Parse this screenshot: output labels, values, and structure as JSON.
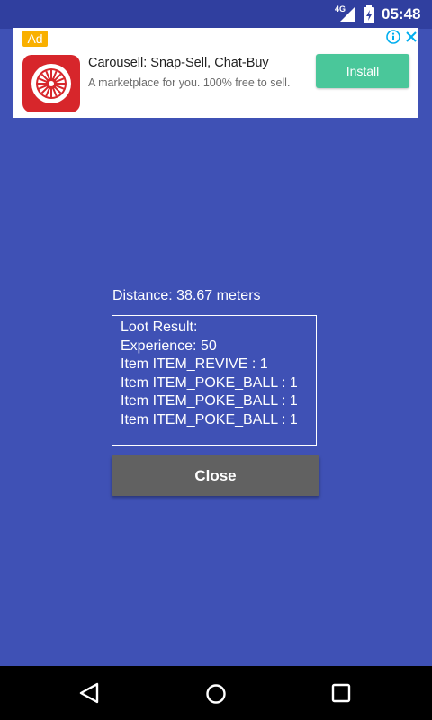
{
  "status_bar": {
    "network_type": "4G",
    "time": "05:48",
    "icons": [
      "signal-icon",
      "battery-icon"
    ]
  },
  "ad": {
    "badge": "Ad",
    "title": "Carousell: Snap-Sell, Chat-Buy",
    "description": "A marketplace for you. 100% free to sell.",
    "install_label": "Install",
    "icons": [
      "ad-info-icon",
      "ad-close-icon",
      "carousell-app-icon"
    ],
    "colors": {
      "install_button": "#4AC79A",
      "badge": "#F9B000",
      "app_icon": "#D7262B"
    }
  },
  "main": {
    "distance_text": "Distance: 38.67 meters",
    "loot_lines": [
      "Loot Result:",
      "Experience: 50",
      "Item ITEM_REVIVE : 1",
      "Item ITEM_POKE_BALL : 1",
      "Item ITEM_POKE_BALL : 1",
      "Item ITEM_POKE_BALL : 1"
    ],
    "close_label": "Close",
    "colors": {
      "background": "#3F51B5",
      "close_button": "#616161"
    }
  },
  "nav_bar": {
    "icons": [
      "back-icon",
      "home-icon",
      "recents-icon"
    ]
  }
}
